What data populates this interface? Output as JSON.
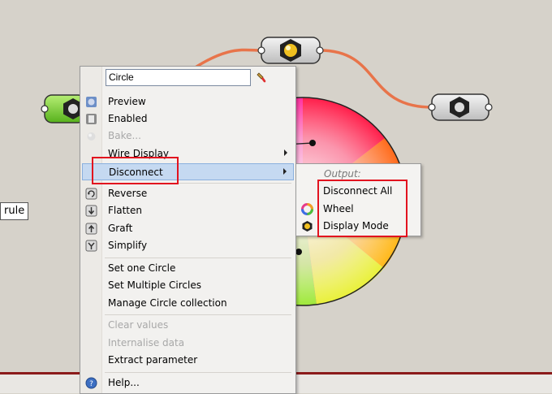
{
  "canvas": {
    "rule_label": "rule",
    "colors": {
      "background": "#d6d2ca",
      "wire": "#e8744a",
      "highlight": "#c5d9f1",
      "red_box": "#e2131f"
    }
  },
  "menu": {
    "name_value": "Circle",
    "items": [
      {
        "label": "Preview"
      },
      {
        "label": "Enabled"
      },
      {
        "label": "Bake..."
      },
      {
        "label": "Wire Display"
      },
      {
        "label": "Disconnect"
      },
      {
        "label": "Reverse"
      },
      {
        "label": "Flatten"
      },
      {
        "label": "Graft"
      },
      {
        "label": "Simplify"
      },
      {
        "label": "Set one Circle"
      },
      {
        "label": "Set Multiple Circles"
      },
      {
        "label": "Manage Circle collection"
      },
      {
        "label": "Clear values"
      },
      {
        "label": "Internalise data"
      },
      {
        "label": "Extract parameter"
      },
      {
        "label": "Help..."
      }
    ]
  },
  "submenu": {
    "header": "Output:",
    "items": [
      {
        "label": "Disconnect All"
      },
      {
        "label": "Wheel"
      },
      {
        "label": "Display Mode"
      }
    ]
  }
}
